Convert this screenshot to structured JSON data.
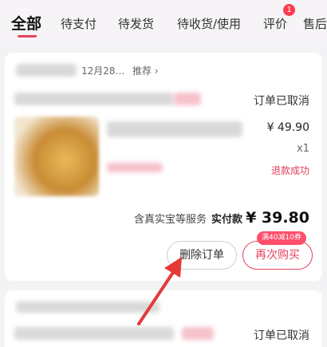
{
  "tabs": [
    {
      "label": "全部"
    },
    {
      "label": "待支付"
    },
    {
      "label": "待发货"
    },
    {
      "label": "待收货/使用"
    },
    {
      "label": "评价"
    },
    {
      "label": "售后"
    }
  ],
  "review_badge": "1",
  "order1": {
    "date": "12月28…",
    "recommend": "推荐",
    "status": "订单已取消",
    "price": "¥ 49.90",
    "quantity": "x1",
    "refund_status": "退款成功",
    "services": "含真实宝等服务",
    "paid_label": "实付款",
    "paid_amount": "¥ 39.80",
    "delete_label": "删除订单",
    "rebuy_label": "再次购买",
    "promo": "满40减10券"
  },
  "order2": {
    "status": "订单已取消"
  },
  "colors": {
    "accent": "#e8425d",
    "refund": "#e23a5a",
    "arrow": "#e53935"
  }
}
